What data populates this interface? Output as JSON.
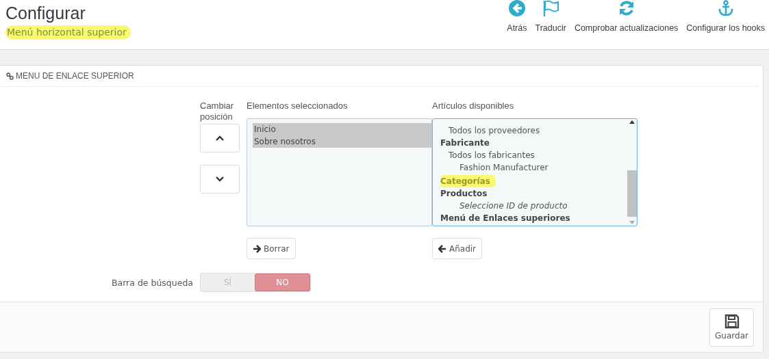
{
  "header": {
    "title": "Configurar",
    "subtitle": {
      "text": "Menú horizontal superior",
      "highlighted": true
    }
  },
  "toolbar": [
    {
      "kind": "back",
      "label": "Atrás"
    },
    {
      "kind": "translate",
      "label": "Traducir"
    },
    {
      "kind": "refresh",
      "label": "Comprobar actualizaciones"
    },
    {
      "kind": "hooks",
      "label": "Configurar los hooks"
    }
  ],
  "panel": {
    "heading": "MENU DE ENLACE SUPERIOR",
    "position": {
      "label": "Cambiar posición"
    },
    "selected_list": {
      "label": "Elementos seleccionados",
      "items": [
        {
          "label": "Inicio",
          "selected": true
        },
        {
          "label": "Sobre nosotros",
          "selected": true
        }
      ],
      "button": "Borrar"
    },
    "available_list": {
      "label": "Artículos disponibles",
      "options": [
        {
          "kind": "group",
          "children": [
            {
              "kind": "item",
              "label": "Todos los proveedores"
            }
          ]
        },
        {
          "kind": "group",
          "label": "Fabricante",
          "children": [
            {
              "kind": "item",
              "label": "Todos los fabricantes",
              "children": [
                {
                  "kind": "item",
                  "label": "Fashion Manufacturer"
                }
              ]
            }
          ]
        },
        {
          "kind": "group",
          "label": "Categorías",
          "highlighted": true
        },
        {
          "kind": "group",
          "label": "Productos",
          "children": [
            {
              "kind": "hint",
              "label": "Seleccione ID de producto"
            }
          ]
        },
        {
          "kind": "group",
          "label": "Menú de Enlaces superiores"
        }
      ],
      "button": "Añadir"
    },
    "search_bar": {
      "label": "Barra de búsqueda",
      "options": [
        {
          "label": "SÍ",
          "selected": false
        },
        {
          "label": "NO",
          "selected": true
        }
      ]
    },
    "save_button": "Guardar"
  }
}
